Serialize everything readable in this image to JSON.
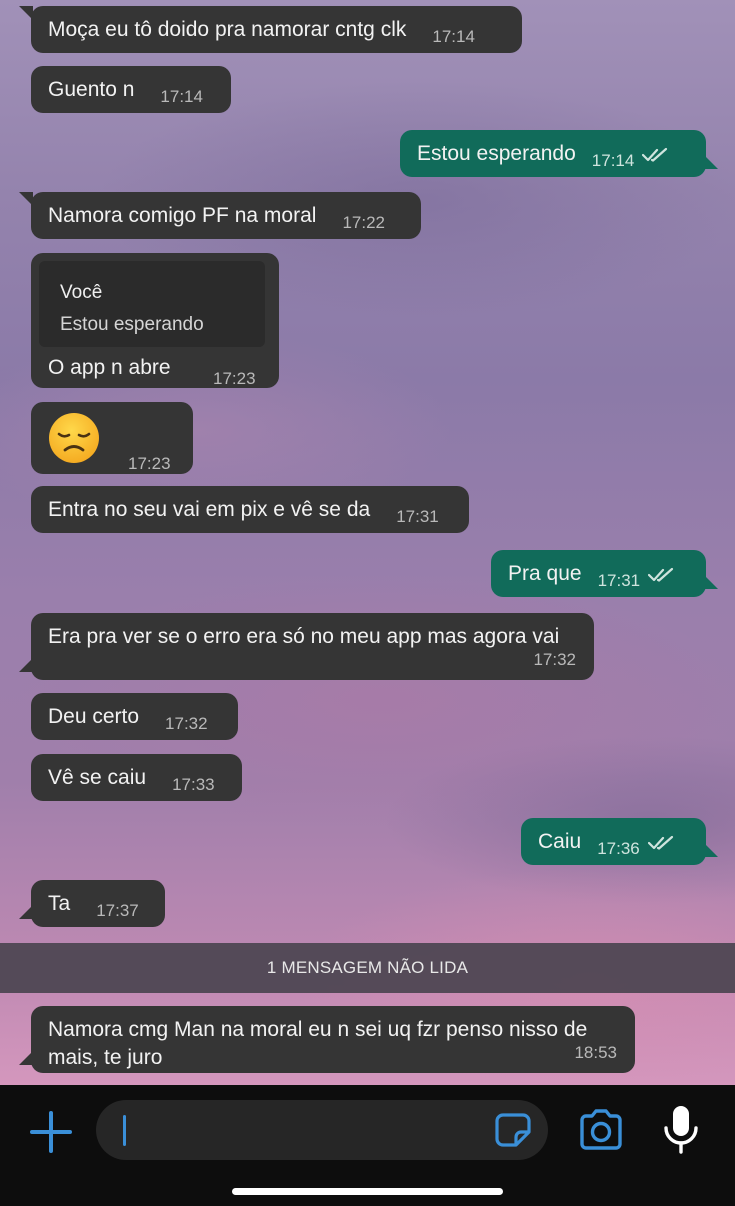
{
  "messages": [
    {
      "id": "m1",
      "side": "in",
      "text": "Moça eu tô doido pra namorar cntg clk",
      "time": "17:14"
    },
    {
      "id": "m2",
      "side": "in",
      "text": "Guento n",
      "time": "17:14"
    },
    {
      "id": "m3",
      "side": "out",
      "text": "Estou esperando",
      "time": "17:14",
      "status": "read"
    },
    {
      "id": "m4",
      "side": "in",
      "text": "Namora comigo PF na moral",
      "time": "17:22"
    },
    {
      "id": "m5",
      "side": "in",
      "reply": {
        "author": "Você",
        "quote": "Estou esperando"
      },
      "text": "O app n abre",
      "time": "17:23"
    },
    {
      "id": "m6",
      "side": "in",
      "emoji": "disappointed-face",
      "time": "17:23"
    },
    {
      "id": "m7",
      "side": "in",
      "text": "Entra no seu vai em pix e vê se da",
      "time": "17:31"
    },
    {
      "id": "m8",
      "side": "out",
      "text": "Pra que",
      "time": "17:31",
      "status": "read"
    },
    {
      "id": "m9",
      "side": "in",
      "text": "Era pra ver se o erro era só no meu app mas agora vai",
      "time": "17:32"
    },
    {
      "id": "m10",
      "side": "in",
      "text": "Deu certo",
      "time": "17:32"
    },
    {
      "id": "m11",
      "side": "in",
      "text": "Vê se caiu",
      "time": "17:33"
    },
    {
      "id": "m12",
      "side": "out",
      "text": "Caiu",
      "time": "17:36",
      "status": "read"
    },
    {
      "id": "m13",
      "side": "in",
      "text": "Ta",
      "time": "17:37"
    },
    {
      "id": "m14",
      "side": "in",
      "text_line1": "Namora cmg Man na moral eu n sei uq fzr penso nisso de",
      "text_line2": "mais, te juro",
      "time": "18:53"
    }
  ],
  "unread_banner": "1 MENSAGEM NÃO LIDA",
  "composer": {
    "icons": [
      "plus-icon",
      "sticker-icon",
      "camera-icon",
      "microphone-icon"
    ],
    "accent": "#3a8fd8"
  },
  "colors": {
    "incoming_bubble": "#353535",
    "outgoing_bubble": "#116b5a",
    "read_check": "#cfe4de"
  }
}
